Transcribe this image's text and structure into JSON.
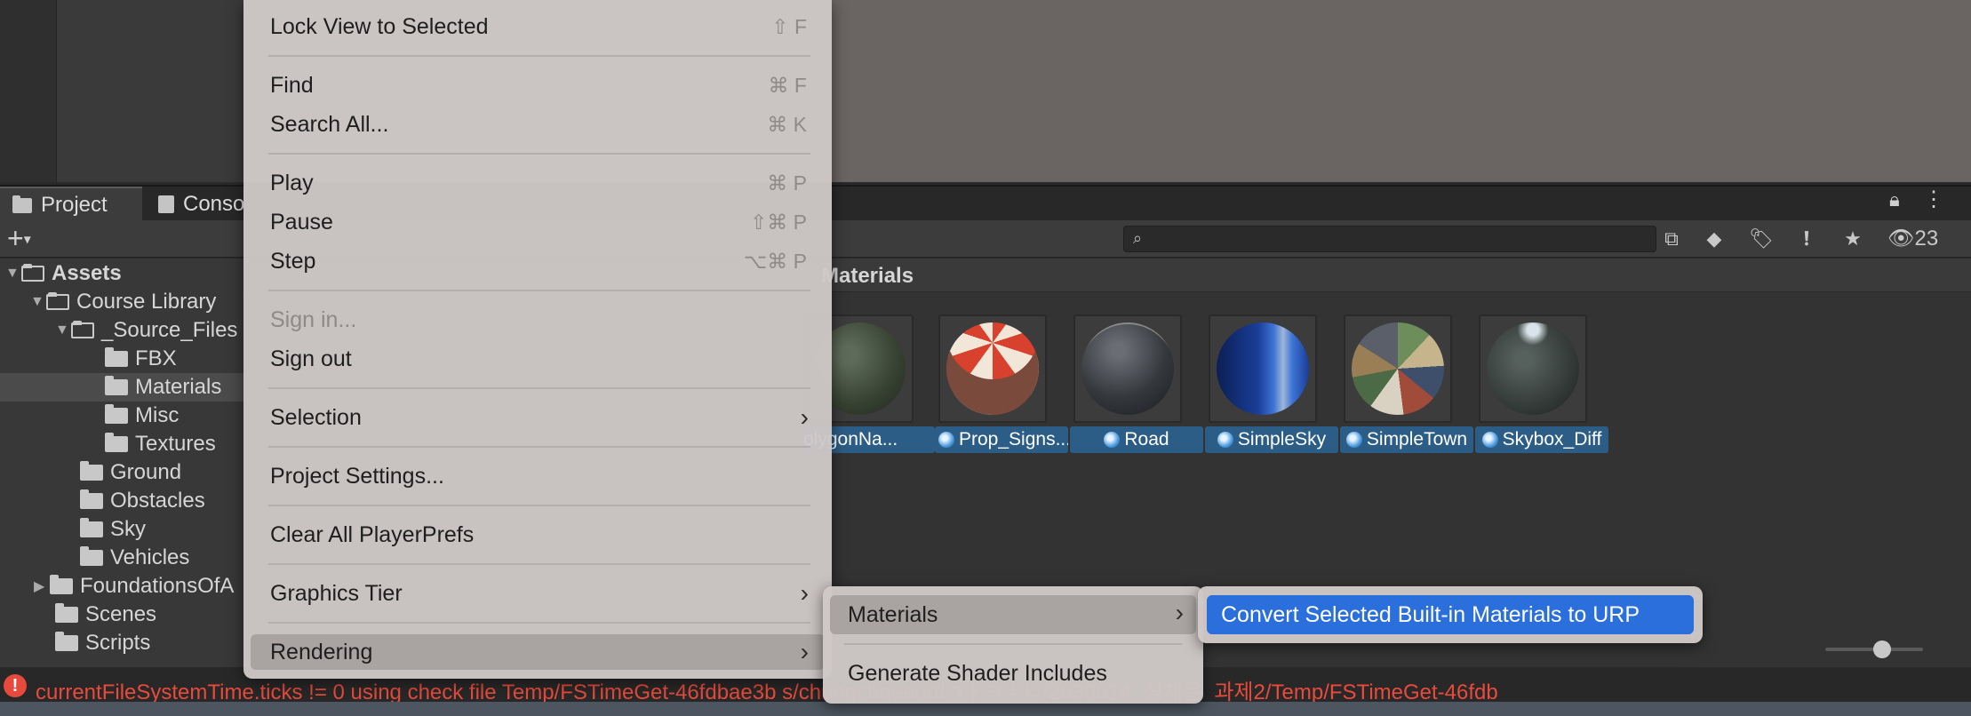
{
  "project_panel": {
    "tabs": [
      {
        "label": "Project",
        "icon": "folder-icon",
        "active": true
      },
      {
        "label": "Conso",
        "icon": "console-icon",
        "active": false
      }
    ],
    "search": {
      "placeholder": "",
      "icon": "search-icon"
    },
    "hidden_count": "23",
    "breadcrumb": "Materials"
  },
  "tree": [
    {
      "label": "Assets",
      "level": 0,
      "expanded": true,
      "bold": true
    },
    {
      "label": "Course Library",
      "level": 1,
      "expanded": true
    },
    {
      "label": "_Source_Files",
      "level": 2,
      "expanded": true
    },
    {
      "label": "FBX",
      "level": 3
    },
    {
      "label": "Materials",
      "level": 3,
      "selected": true
    },
    {
      "label": "Misc",
      "level": 3
    },
    {
      "label": "Textures",
      "level": 3
    },
    {
      "label": "Ground",
      "level": 2
    },
    {
      "label": "Obstacles",
      "level": 2
    },
    {
      "label": "Sky",
      "level": 2
    },
    {
      "label": "Vehicles",
      "level": 2
    },
    {
      "label": "FoundationsOfA",
      "level": 1,
      "collapsed": true
    },
    {
      "label": "Scenes",
      "level": 1
    },
    {
      "label": "Scripts",
      "level": 1
    }
  ],
  "assets": [
    {
      "label": "olygonNa...",
      "show_dot": false
    },
    {
      "label": "Prop_Signs...",
      "show_dot": true
    },
    {
      "label": "Road",
      "show_dot": true
    },
    {
      "label": "SimpleSky",
      "show_dot": true
    },
    {
      "label": "SimpleTown",
      "show_dot": true
    },
    {
      "label": "Skybox_Diff",
      "show_dot": true
    }
  ],
  "menu": {
    "items": [
      {
        "label": "Lock View to Selected",
        "shortcut": "⇧ F"
      },
      {
        "label": "Find",
        "shortcut": "⌘ F"
      },
      {
        "label": "Search All...",
        "shortcut": "⌘ K"
      },
      {
        "label": "Play",
        "shortcut": "⌘ P"
      },
      {
        "label": "Pause",
        "shortcut": "⇧⌘ P"
      },
      {
        "label": "Step",
        "shortcut": "⌥⌘ P"
      },
      {
        "label": "Sign in...",
        "disabled": true
      },
      {
        "label": "Sign out"
      },
      {
        "label": "Selection",
        "submenu": true
      },
      {
        "label": "Project Settings..."
      },
      {
        "label": "Clear All PlayerPrefs"
      },
      {
        "label": "Graphics Tier",
        "submenu": true
      },
      {
        "label": "Rendering",
        "submenu": true,
        "highlighted": true
      }
    ],
    "submenu_arrow": "›"
  },
  "rendering_submenu": {
    "items": [
      {
        "label": "Materials",
        "submenu": true,
        "highlighted": true
      },
      {
        "label": "Generate Shader Includes"
      }
    ]
  },
  "materials_submenu": {
    "items": [
      {
        "label": "Convert Selected Built-in Materials to URP",
        "highlighted": true
      }
    ]
  },
  "status": {
    "icon": "!",
    "message": "currentFileSystemTime.ticks != 0 using check file Temp/FSTimeGet-46fdbae3b                                    s/chungchaeeun/ㄱㅏㅋㅗㄴ/2030014_정채은_과제2/Temp/FSTimeGet-46fdb"
  },
  "colors": {
    "menu_bg": "#cec8c7",
    "highlight_blue": "#2a6fdb",
    "error_red": "#e84b3c",
    "asset_label_bg": "#2c5d87"
  }
}
